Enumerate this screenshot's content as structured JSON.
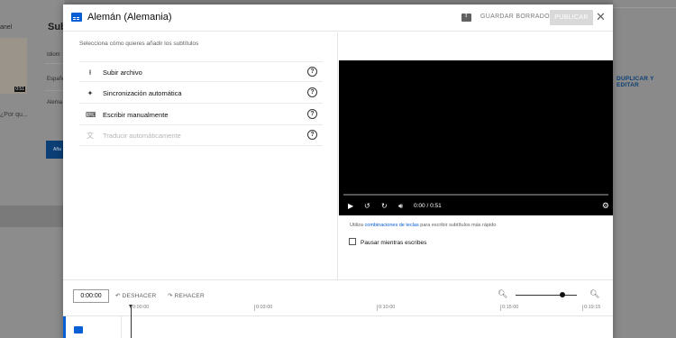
{
  "background": {
    "left_label": "anel",
    "thumb_duration": "0:51",
    "left_note": "¿Por qu...",
    "subtitle_heading": "Subt",
    "rows": [
      "Idiom",
      "Españo",
      "Alema"
    ],
    "blue_button": "Aña",
    "duplicate_label": "DUPLICAR Y EDITAR"
  },
  "modal": {
    "title": "Alemán (Alemania)",
    "save_draft": "GUARDAR BORRADOR",
    "publish": "PUBLICAR",
    "close": "✕"
  },
  "left_panel": {
    "prompt": "Selecciona cómo quieres añadir los subtítulos",
    "options": [
      {
        "label": "Subir archivo",
        "icon": "upload-icon",
        "glyph": "⭱",
        "enabled": true
      },
      {
        "label": "Sincronización automática",
        "icon": "sparkle-icon",
        "glyph": "✦",
        "enabled": true
      },
      {
        "label": "Escribir manualmente",
        "icon": "keyboard-icon",
        "glyph": "⌨",
        "enabled": true
      },
      {
        "label": "Traducir automáticamente",
        "icon": "translate-icon",
        "glyph": "文",
        "enabled": false
      }
    ]
  },
  "player": {
    "current_time": "0:00",
    "duration": "0:51",
    "time_display": "0:00 / 0:51",
    "progress": 0
  },
  "hint": {
    "prefix": "Utiliza ",
    "link": "combinaciones de teclas",
    "suffix": " para escribir subtítulos más rápido"
  },
  "pause_checkbox": {
    "label": "Pausar mientras escribes",
    "checked": false
  },
  "timeline": {
    "timecode": "0:00:00",
    "undo": "DESHACER",
    "redo": "REHACER",
    "ticks": [
      "0:00:00",
      "0:03:00",
      "0:10:00",
      "0:15:00",
      "0:19:15"
    ]
  },
  "colors": {
    "accent": "#065fd4",
    "player_bg": "#000000"
  }
}
